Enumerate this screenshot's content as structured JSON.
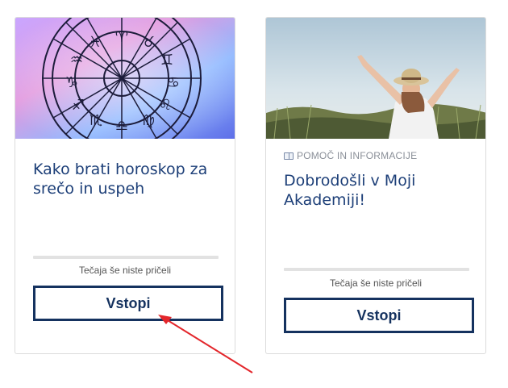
{
  "courses": [
    {
      "title": "Kako brati horoskop za srečo in uspeh",
      "category": "",
      "status": "Tečaja še niste pričeli",
      "button_label": "Vstopi",
      "progress": 0,
      "image": "zodiac-wheel"
    },
    {
      "title": "Dobrodošli v Moji Akademiji!",
      "category": "POMOČ IN INFORMACIJE",
      "status": "Tečaja še niste pričeli",
      "button_label": "Vstopi",
      "progress": 0,
      "image": "woman-raising-arms"
    }
  ],
  "colors": {
    "accent": "#15325f",
    "title": "#1d3f78",
    "arrow": "#e3262b",
    "progress_track": "#e2e2e2"
  }
}
